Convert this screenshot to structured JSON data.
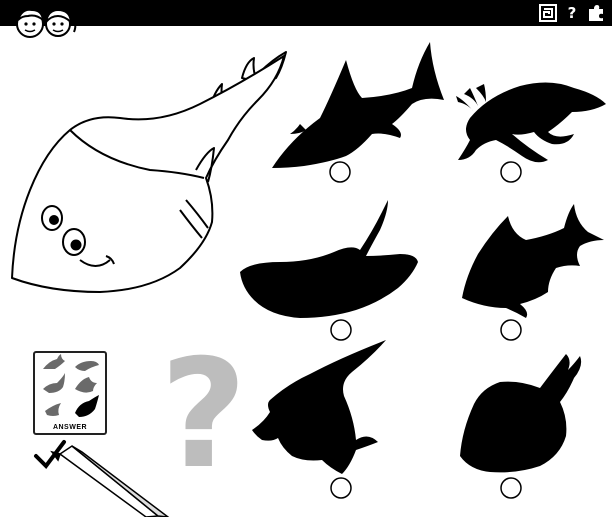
{
  "header": {
    "maze_icon": "maze-icon",
    "help_label": "?",
    "puzzle_icon": "puzzle-icon"
  },
  "answer_card": {
    "label": "ANSWER"
  },
  "question_mark": {
    "text": "?"
  },
  "colors": {
    "background": "#ffffff",
    "silhouette": "#000000",
    "question_mark": "#bdbdbd",
    "answer_thumbs": "#6a6a6a"
  },
  "options": [
    {
      "name": "shark-silhouette"
    },
    {
      "name": "axolotl-silhouette"
    },
    {
      "name": "stingray-silhouette"
    },
    {
      "name": "triggerfish-silhouette"
    },
    {
      "name": "angelfish-silhouette"
    },
    {
      "name": "guitarfish-silhouette"
    }
  ]
}
